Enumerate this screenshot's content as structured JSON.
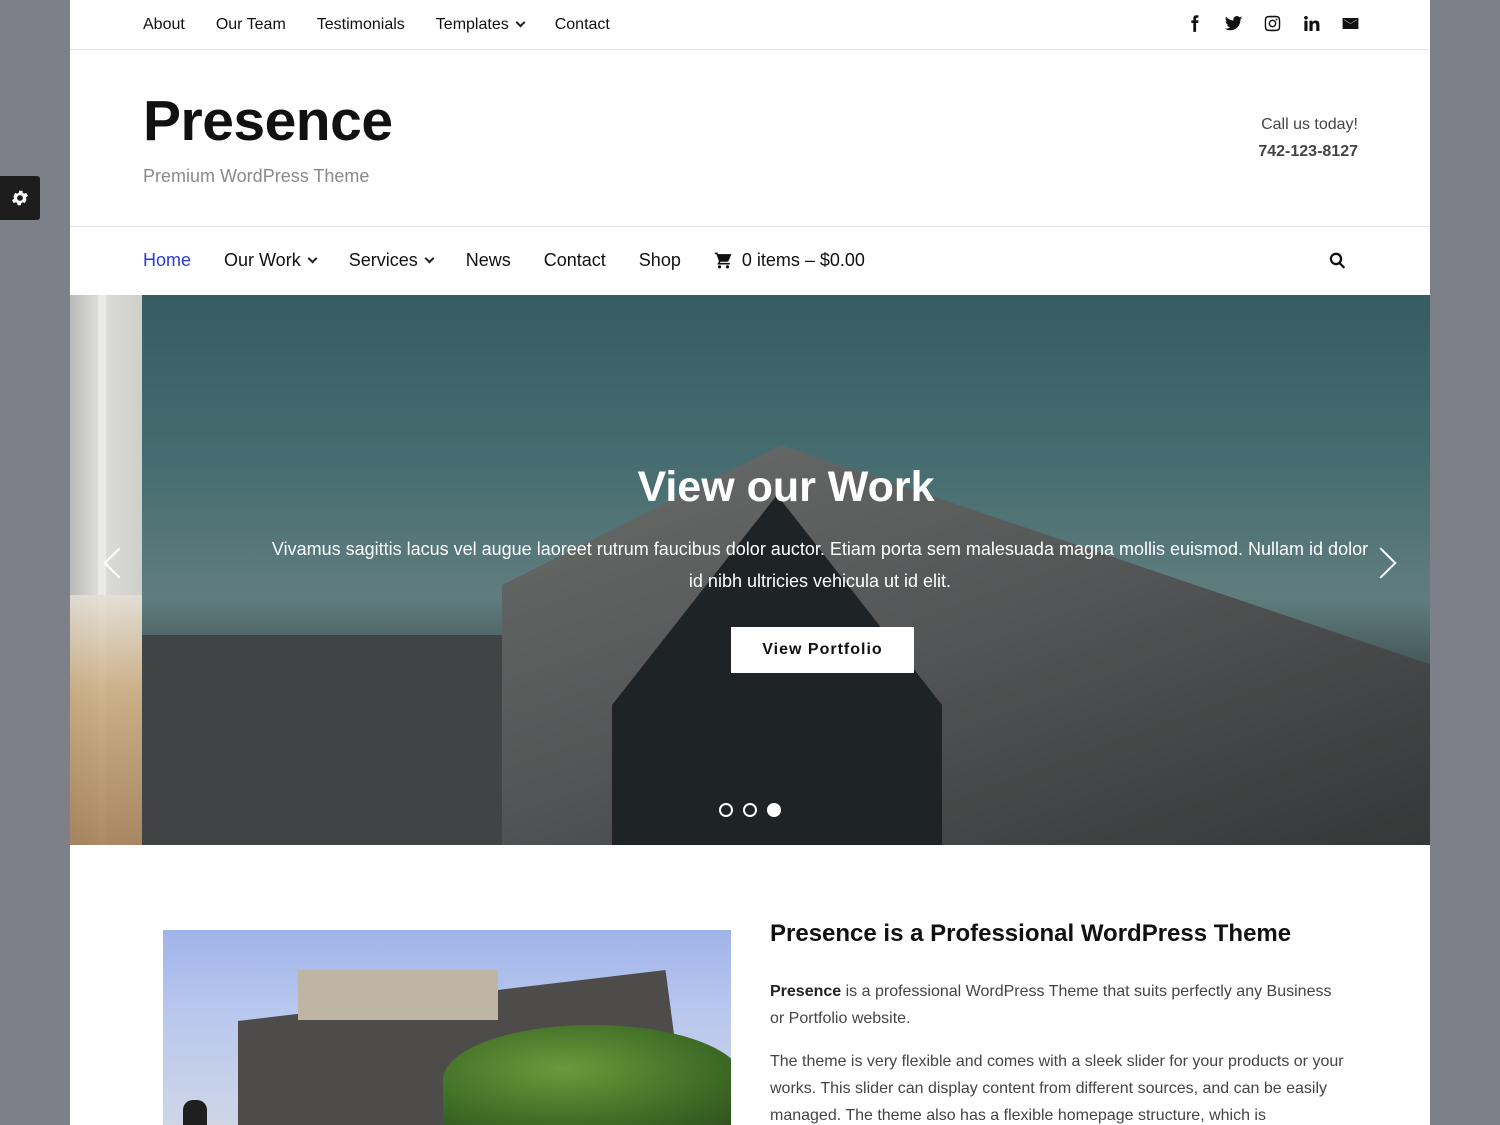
{
  "topnav": {
    "items": [
      {
        "label": "About"
      },
      {
        "label": "Our Team"
      },
      {
        "label": "Testimonials"
      },
      {
        "label": "Templates",
        "dropdown": true
      },
      {
        "label": "Contact"
      }
    ]
  },
  "social": {
    "icons": [
      "facebook-icon",
      "twitter-icon",
      "instagram-icon",
      "linkedin-icon",
      "email-icon"
    ]
  },
  "header": {
    "site_title": "Presence",
    "tagline": "Premium WordPress Theme",
    "call_label": "Call us today!",
    "phone": "742-123-8127"
  },
  "mainnav": {
    "items": [
      {
        "label": "Home",
        "active": true
      },
      {
        "label": "Our Work",
        "dropdown": true
      },
      {
        "label": "Services",
        "dropdown": true
      },
      {
        "label": "News"
      },
      {
        "label": "Contact"
      },
      {
        "label": "Shop"
      }
    ],
    "cart_label": "0 items – $0.00"
  },
  "slider": {
    "title": "View our Work",
    "text": "Vivamus sagittis lacus vel augue laoreet rutrum faucibus dolor auctor. Etiam porta sem malesuada magna mollis euismod. Nullam id dolor id nibh ultricies vehicula ut id elit.",
    "button_label": "View Portfolio",
    "dots": 3,
    "active_dot": 3
  },
  "intro": {
    "title": "Presence is a Professional WordPress Theme",
    "p1_bold": "Presence",
    "p1_rest": " is a professional WordPress Theme that suits perfectly any Business or Portfolio website.",
    "p2": "The theme is very flexible and comes with a sleek slider for your products or your works. This slider can display content from different sources, and can be easily managed. The theme also has a flexible homepage structure, which is"
  },
  "colors": {
    "accent": "#2a3bd6",
    "backdrop": "#7d8088"
  }
}
